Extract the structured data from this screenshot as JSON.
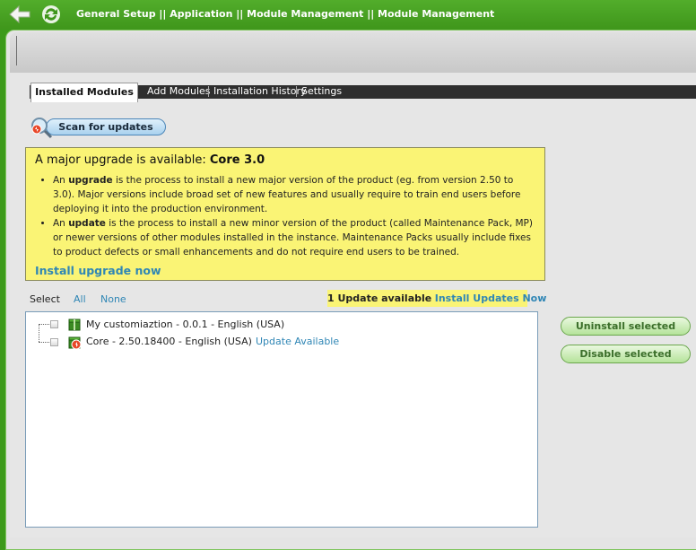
{
  "header": {
    "breadcrumb": "General Setup || Application || Module Management  ||  Module Management"
  },
  "tabs": [
    {
      "label": "Installed Modules",
      "active": true
    },
    {
      "label": "Add Modules",
      "active": false
    },
    {
      "label": "Installation History",
      "active": false
    },
    {
      "label": "Settings",
      "active": false
    }
  ],
  "scan_button": {
    "label": "Scan for updates"
  },
  "notice": {
    "title_prefix": "A major upgrade is available:",
    "title_version": "Core 3.0",
    "bullets": [
      {
        "pre": "An ",
        "term": "upgrade",
        "text": " is the process to install a new major version of the product (eg. from version 2.50 to 3.0). Major versions include broad set of new features and usually require to train end users before deploying it into the production environment."
      },
      {
        "pre": "An ",
        "term": "update",
        "text": " is the process to install a new minor version of the product (called Maintenance Pack, MP) or newer versions of other modules installed in the instance. Maintenance Packs usually include fixes to product defects or small enhancements and do not require end users to be trained."
      }
    ],
    "install_link": "Install upgrade now"
  },
  "select": {
    "label": "Select",
    "all": "All",
    "none": "None"
  },
  "update_banner": {
    "count_text": "1 Update available",
    "link": "Install Updates Now"
  },
  "modules": [
    {
      "label": "My customiaztion - 0.0.1 - English (USA)",
      "update": ""
    },
    {
      "label": "Core - 2.50.18400 - English (USA)",
      "update": "Update Available"
    }
  ],
  "actions": {
    "uninstall": "Uninstall selected",
    "disable": "Disable selected"
  },
  "colors": {
    "topbar": "#4aa324",
    "notice": "#faf475",
    "link": "#2f86b5",
    "tab_strip": "#2e2e2e"
  }
}
